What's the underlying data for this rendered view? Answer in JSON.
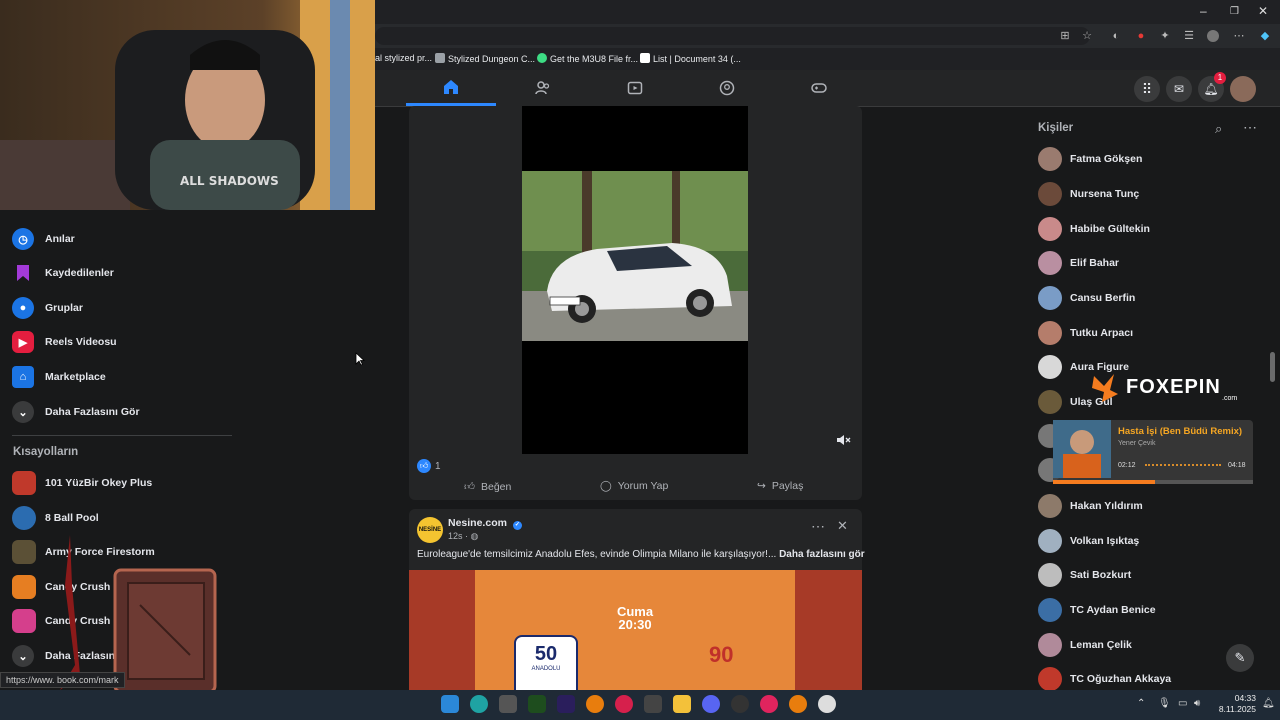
{
  "browser": {
    "bookmarks": [
      {
        "label": "al stylized pr...",
        "color": "#3a3a3a"
      },
      {
        "label": "Stylized Dungeon C...",
        "color": "#5f6368"
      },
      {
        "label": "Get the M3U8 File fr...",
        "color": "#3ddc84"
      },
      {
        "label": "List | Document 34 (...",
        "color": "#ffffff"
      }
    ],
    "status_url": "https://www.     book.com/mark"
  },
  "left_nav": {
    "items": [
      {
        "label": "Anılar",
        "icon": "clock-icon",
        "color": "#1b74e4"
      },
      {
        "label": "Kaydedilenler",
        "icon": "bookmark-icon",
        "color": "#a33ad9"
      },
      {
        "label": "Gruplar",
        "icon": "groups-icon",
        "color": "#1b74e4"
      },
      {
        "label": "Reels Videosu",
        "icon": "reels-icon",
        "color": "#e41e3f"
      },
      {
        "label": "Marketplace",
        "icon": "store-icon",
        "color": "#1b74e4"
      },
      {
        "label": "Daha Fazlasını Gör",
        "icon": "chevron-down-icon",
        "color": "#3a3b3c"
      }
    ],
    "shortcuts_title": "Kısayolların",
    "shortcuts": [
      {
        "label": "101 YüzBir Okey Plus",
        "color": "#c0392b"
      },
      {
        "label": "8 Ball Pool",
        "color": "#2b6cb0"
      },
      {
        "label": "Army Force Firestorm",
        "color": "#5b5036"
      },
      {
        "label": "Candy Crush Saga",
        "color": "#e67e22"
      },
      {
        "label": "Candy Crush Soda",
        "color": "#d53f8c"
      },
      {
        "label": "Daha Fazlasını Gör",
        "color": "#3a3b3c"
      }
    ]
  },
  "post1": {
    "like_count": "1",
    "actions": {
      "like": "Beğen",
      "comment": "Yorum Yap",
      "share": "Paylaş"
    }
  },
  "post2": {
    "author": "Nesine.com",
    "time": "12s · ",
    "text": "Euroleague'de temsilcimiz Anadolu Efes, evinde Olimpia Milano ile karşılaşıyor!... ",
    "more": "Daha fazlasını gör",
    "banner_day": "Cuma",
    "banner_time": "20:30",
    "badge_left": "50",
    "badge_left_sub": "ANADOLU",
    "badge_right": "90"
  },
  "contacts": {
    "title": "Kişiler",
    "list": [
      {
        "name": "Fatma Gökşen",
        "color": "#9a7b6f"
      },
      {
        "name": "Nursena Tunç",
        "color": "#6b4a3a"
      },
      {
        "name": "Habibe Gültekin",
        "color": "#c98a8a"
      },
      {
        "name": "Elif Bahar",
        "color": "#b98fa1"
      },
      {
        "name": "Cansu Berfin",
        "color": "#7a9cc6"
      },
      {
        "name": "Tutku Arpacı",
        "color": "#b57d6b"
      },
      {
        "name": "Aura Figure",
        "color": "#d8d8d8"
      },
      {
        "name": "Ulaş Gül",
        "color": "#6a5a3a"
      },
      {
        "name": "Hakan Yıldırım",
        "color": "#8d7a6a"
      },
      {
        "name": "Volkan Işıktaş",
        "color": "#a0b0c0"
      },
      {
        "name": "Sati Bozkurt",
        "color": "#bdbdbd"
      },
      {
        "name": "TC Aydan Benice",
        "color": "#3b6ea5"
      },
      {
        "name": "Leman Çelik",
        "color": "#b08a9a"
      },
      {
        "name": "TC Oğuzhan Akkaya",
        "color": "#c0392b"
      }
    ]
  },
  "overlay": {
    "logo": "FOXEPIN",
    "logo_sub": ".com",
    "song_title": "Hasta İşi (Ben Büdü Remix)",
    "song_artist": "Yener Çevik",
    "time_elapsed": "02:12",
    "time_total": "04:18",
    "progress": 0.51
  },
  "notifications_count": "1",
  "clock": {
    "time": "04:33",
    "date": "8.11.2025"
  },
  "colors": {
    "fb_blue": "#2d88ff",
    "bg": "#18191a",
    "card": "#242526"
  }
}
